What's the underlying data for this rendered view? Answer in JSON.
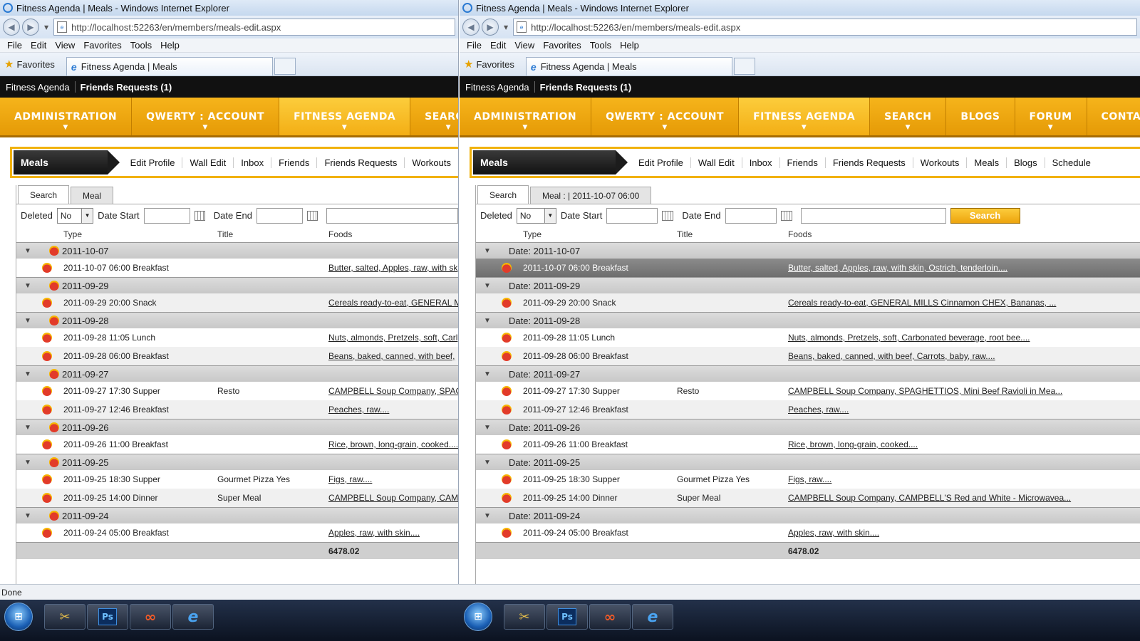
{
  "browser": {
    "title": "Fitness Agenda | Meals - Windows Internet Explorer",
    "url": "http://localhost:52263/en/members/meals-edit.aspx",
    "menu": [
      "File",
      "Edit",
      "View",
      "Favorites",
      "Tools",
      "Help"
    ],
    "favorites_label": "Favorites",
    "tab_label": "Fitness Agenda | Meals",
    "status": "Done"
  },
  "site": {
    "brand": "Fitness Agenda",
    "friend_requests": "Friends Requests (1)",
    "main_nav": [
      "ADMINISTRATION",
      "QWERTY : ACCOUNT",
      "FITNESS AGENDA",
      "SEARCH",
      "BLOGS",
      "FORUM",
      "CONTACT U"
    ],
    "section_title": "Meals",
    "sub_nav": [
      "Edit Profile",
      "Wall Edit",
      "Inbox",
      "Friends",
      "Friends Requests",
      "Workouts",
      "Meals",
      "Blogs",
      "Schedule"
    ]
  },
  "left": {
    "tabs": [
      "Search",
      "Meal"
    ]
  },
  "right": {
    "tabs": [
      "Search",
      "Meal : | 2011-10-07 06:00"
    ],
    "search_button": "Search"
  },
  "filter": {
    "deleted_label": "Deleted",
    "deleted_value": "No",
    "date_start_label": "Date Start",
    "date_end_label": "Date End"
  },
  "columns": {
    "type": "Type",
    "title": "Title",
    "foods": "Foods"
  },
  "groups_left": [
    "2011-10-07",
    "2011-09-29",
    "2011-09-28",
    "2011-09-27",
    "2011-09-26",
    "2011-09-25",
    "2011-09-24"
  ],
  "groups_right": [
    "Date: 2011-10-07",
    "Date: 2011-09-29",
    "Date: 2011-09-28",
    "Date: 2011-09-27",
    "Date: 2011-09-26",
    "Date: 2011-09-25",
    "Date: 2011-09-24"
  ],
  "rows": [
    {
      "type": "2011-10-07 06:00 Breakfast",
      "title": "",
      "foods_left": "Butter, salted, Apples, raw, with sk",
      "foods_right": "Butter, salted, Apples, raw, with skin, Ostrich, tenderloin...."
    },
    {
      "type": "2011-09-29 20:00 Snack",
      "title": "",
      "foods_left": "Cereals ready-to-eat, GENERAL M",
      "foods_right": "Cereals ready-to-eat, GENERAL MILLS Cinnamon CHEX, Bananas, ..."
    },
    {
      "type": "2011-09-28 11:05 Lunch",
      "title": "",
      "foods_left": "Nuts, almonds, Pretzels, soft, Carl",
      "foods_right": "Nuts, almonds, Pretzels, soft, Carbonated beverage, root bee...."
    },
    {
      "type": "2011-09-28 06:00 Breakfast",
      "title": "",
      "foods_left": "Beans, baked, canned, with beef,",
      "foods_right": "Beans, baked, canned, with beef, Carrots, baby, raw...."
    },
    {
      "type": "2011-09-27 17:30 Supper",
      "title": "Resto",
      "foods_left": "CAMPBELL Soup Company, SPAC",
      "foods_right": "CAMPBELL Soup Company, SPAGHETTIOS, Mini Beef Ravioli in Mea..."
    },
    {
      "type": "2011-09-27 12:46 Breakfast",
      "title": "",
      "foods_left": "Peaches, raw....",
      "foods_right": "Peaches, raw...."
    },
    {
      "type": "2011-09-26 11:00 Breakfast",
      "title": "",
      "foods_left": "Rice, brown, long-grain, cooked....",
      "foods_right": "Rice, brown, long-grain, cooked...."
    },
    {
      "type": "2011-09-25 18:30 Supper",
      "title": "Gourmet Pizza Yes",
      "foods_left": "Figs, raw....",
      "foods_right": "Figs, raw...."
    },
    {
      "type": "2011-09-25 14:00 Dinner",
      "title": "Super Meal",
      "foods_left": "CAMPBELL Soup Company, CAM",
      "foods_right": "CAMPBELL Soup Company, CAMPBELL'S Red and White - Microwavea..."
    },
    {
      "type": "2011-09-24 05:00 Breakfast",
      "title": "",
      "foods_left": "Apples, raw, with skin....",
      "foods_right": "Apples, raw, with skin...."
    }
  ],
  "total": "6478.02",
  "taskbar": {
    "ps_label": "Ps"
  }
}
